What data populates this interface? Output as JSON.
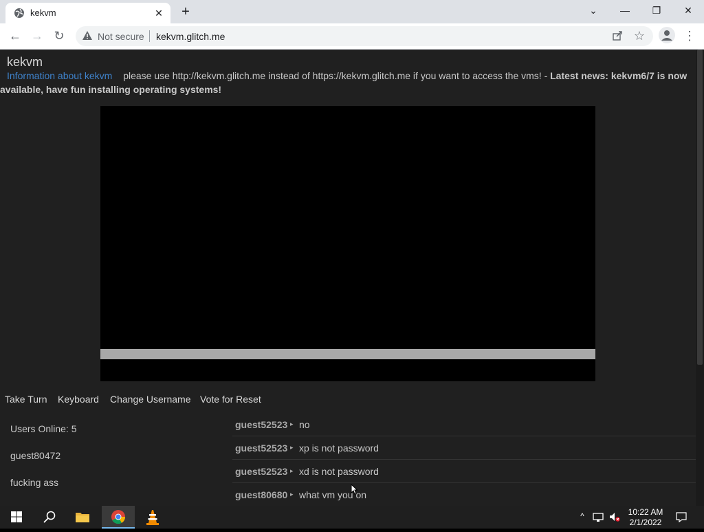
{
  "browser": {
    "tab_title": "kekvm",
    "security_label": "Not secure",
    "url": "kekvm.glitch.me"
  },
  "page": {
    "brand": "kekvm",
    "info_link": "Information about kekvm",
    "notice": "please use http://kekvm.glitch.me instead of https://kekvm.glitch.me if you want to access the vms! - ",
    "news": "Latest news: kekvm6/7 is now available, have fun installing operating systems!"
  },
  "controls": {
    "take_turn": "Take Turn",
    "keyboard": "Keyboard",
    "change_username": "Change Username",
    "vote_reset": "Vote for Reset"
  },
  "users": {
    "online": "Users Online: 5",
    "list": [
      "guest80472",
      "fucking ass"
    ]
  },
  "chat": [
    {
      "user": "guest52523",
      "text": "no"
    },
    {
      "user": "guest52523",
      "text": "xp is not password"
    },
    {
      "user": "guest52523",
      "text": "xd is not password"
    },
    {
      "user": "guest80680",
      "text": "what vm you on"
    }
  ],
  "taskbar": {
    "time": "10:22 AM",
    "date": "2/1/2022"
  },
  "colors": {
    "page_bg": "#202020",
    "link": "#3f83cc",
    "taskbar_bg": "#1f1f1f"
  }
}
